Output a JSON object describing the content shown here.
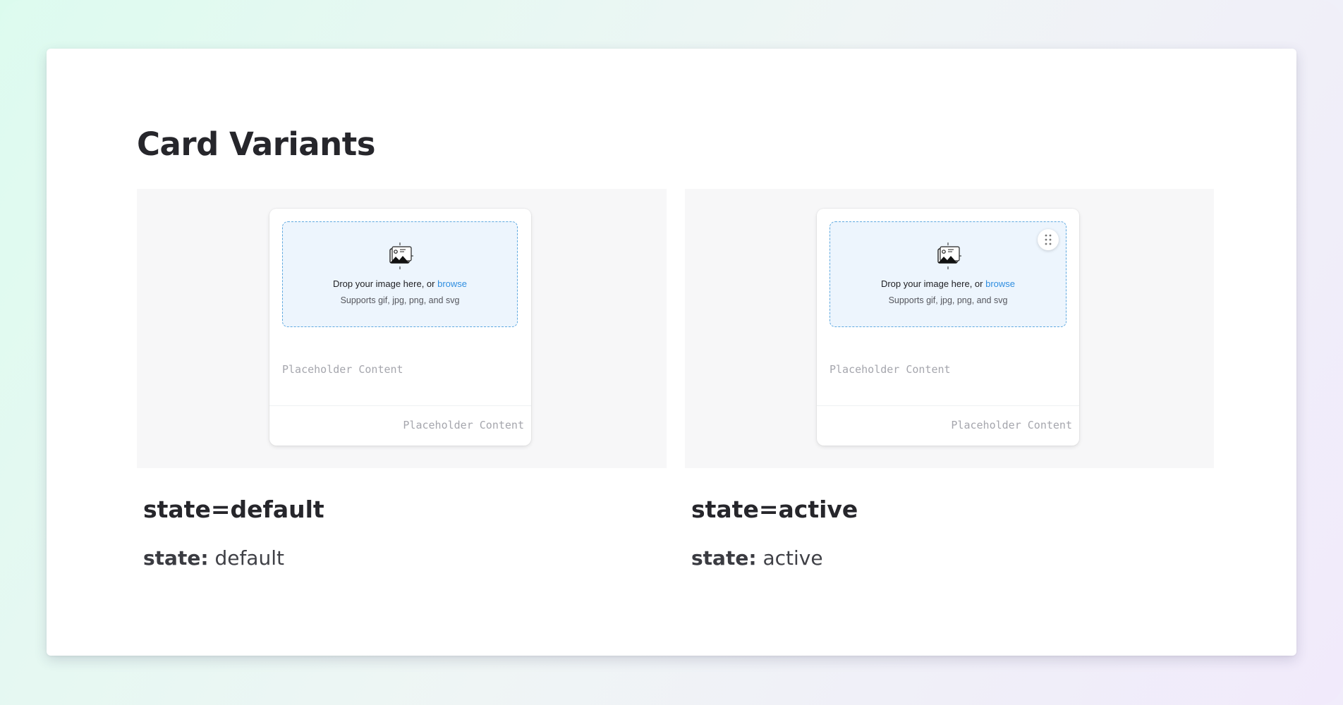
{
  "page": {
    "title": "Card Variants"
  },
  "colors": {
    "dropzone_bg": "#edf5fd",
    "dropzone_border": "#5fa9e0",
    "link": "#2f8ee0",
    "placeholder": "#a5a6ad"
  },
  "variants": [
    {
      "name": "state=default",
      "prop_key": "state:",
      "prop_value": "default",
      "card": {
        "dropzone_icon": "image-upload-icon",
        "dropzone_text": "Drop your image here, or ",
        "dropzone_link": "browse",
        "dropzone_hint": "Supports gif, jpg, png, and svg",
        "body_text": "Placeholder Content",
        "footer_text": "Placeholder Content"
      }
    },
    {
      "name": "state=active",
      "prop_key": "state:",
      "prop_value": "active",
      "card": {
        "dropzone_icon": "image-upload-icon",
        "dropzone_text": "Drop your image here, or ",
        "dropzone_link": "browse",
        "dropzone_hint": "Supports gif, jpg, png, and svg",
        "body_text": "Placeholder Content",
        "footer_text": "Placeholder Content",
        "handle_icon": "drag-handle-icon"
      }
    }
  ]
}
